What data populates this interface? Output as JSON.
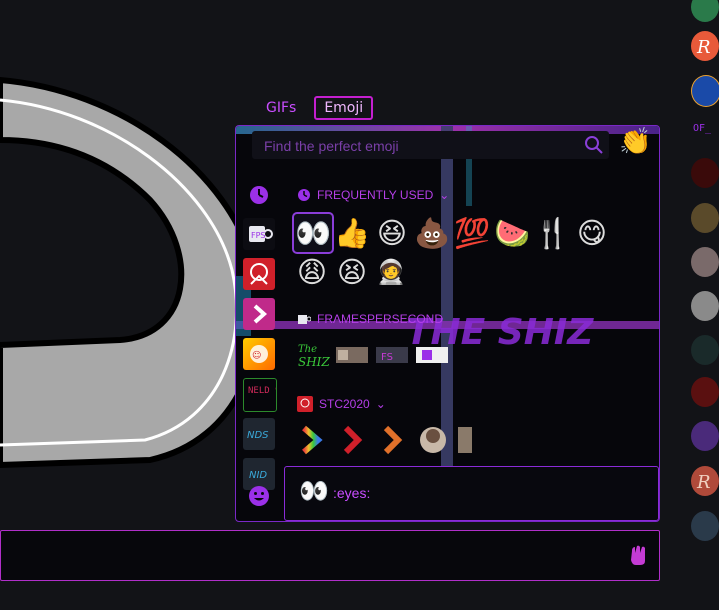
{
  "tabs": [
    {
      "label": "GIFs"
    },
    {
      "label": "Emoji"
    }
  ],
  "search": {
    "placeholder": "Find the perfect emoji"
  },
  "categories": {
    "frequent": {
      "label": "FREQUENTLY USED"
    },
    "guild1": {
      "label": "FRAMESPERSECOND"
    },
    "guild2": {
      "label": "STC2020"
    }
  },
  "frequent_emojis": [
    "👀",
    "👍",
    "😆",
    "💩",
    "💯",
    "🍉",
    "🍴",
    "😋",
    "😩",
    "😫",
    "🧑‍🚀"
  ],
  "preview": {
    "emoji": "👀",
    "name": ":eyes:"
  },
  "rail": {
    "label": "OF_"
  },
  "sidebar_labels": {
    "nds": "NDS",
    "nid": "NID",
    "neld": "NELD 99"
  },
  "colors": {
    "accent": "#b93ae6",
    "border": "#7a28c7",
    "bg": "#121317"
  }
}
